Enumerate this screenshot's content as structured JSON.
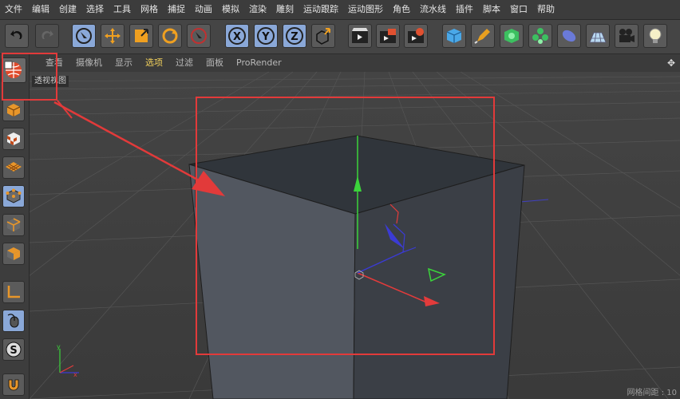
{
  "menubar": {
    "items": [
      "文件",
      "编辑",
      "创建",
      "选择",
      "工具",
      "网格",
      "捕捉",
      "动画",
      "模拟",
      "渲染",
      "雕刻",
      "运动跟踪",
      "运动图形",
      "角色",
      "流水线",
      "插件",
      "脚本",
      "窗口",
      "帮助"
    ]
  },
  "toolbar": {
    "icons": [
      "undo-icon",
      "redo-icon",
      "live-select-icon",
      "move-icon",
      "scale-icon",
      "rotate-icon",
      "recent-tool-icon",
      "x-axis-icon",
      "y-axis-icon",
      "z-axis-icon",
      "coordinate-system-icon",
      "render-view-icon",
      "render-to-picture-viewer-icon",
      "render-settings-icon",
      "cube-icon",
      "pen-icon",
      "subdivision-icon",
      "mograph-cloner-icon",
      "deformer-icon",
      "floor-icon",
      "camera-icon",
      "light-icon"
    ],
    "axis_labels": [
      "X",
      "Y",
      "Z"
    ]
  },
  "viewport": {
    "menu": [
      "查看",
      "摄像机",
      "显示",
      "选项",
      "过滤",
      "面板",
      "ProRender"
    ],
    "selected_menu": "选项",
    "label": "透视视图",
    "grid_spacing": "网格间距 : 10"
  },
  "colors": {
    "selected_menu": "#f2d15c",
    "annotation": "#e23a3a",
    "x_axis": "#e33b3b",
    "y_axis": "#3bd43b",
    "z_axis": "#3b3bd4",
    "toolbar_highlight": "#8aa8d8"
  }
}
